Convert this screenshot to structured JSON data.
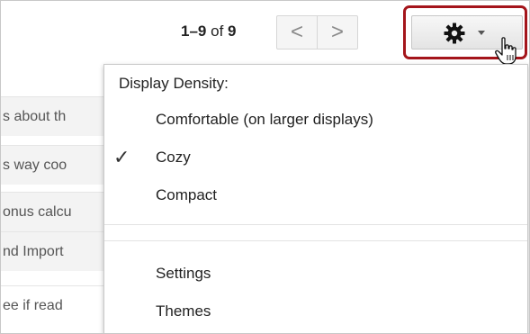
{
  "toolbar": {
    "range": "1–9",
    "of_label": "of",
    "total": "9",
    "prev_glyph": "<",
    "next_glyph": ">",
    "settings_icon": "gear-icon",
    "accent_outline_color": "#a4151b"
  },
  "background_rows": [
    "s about th",
    "s way coo",
    "onus calcu",
    "nd Import",
    "ee if read"
  ],
  "menu": {
    "header": "Display Density:",
    "density_options": [
      {
        "label": "Comfortable (on larger displays)",
        "checked": false
      },
      {
        "label": "Cozy",
        "checked": true
      },
      {
        "label": "Compact",
        "checked": false
      }
    ],
    "check_glyph": "✓",
    "links": [
      {
        "label": "Settings"
      },
      {
        "label": "Themes"
      }
    ]
  }
}
